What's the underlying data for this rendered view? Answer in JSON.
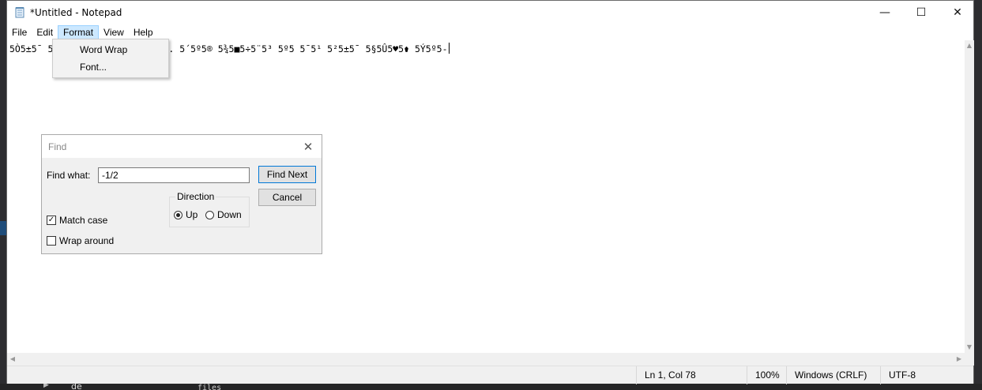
{
  "window": {
    "title": "*Untitled - Notepad",
    "minimize_glyph": "—",
    "maximize_glyph": "☐",
    "close_glyph": "✕"
  },
  "menu": {
    "file": "File",
    "edit": "Edit",
    "format": "Format",
    "view": "View",
    "help": "Help"
  },
  "format_menu": {
    "word_wrap": "Word Wrap",
    "font": "Font..."
  },
  "editor": {
    "text_start": "5Ò5±5¯ 5",
    "text_end": ". 5´5º5® 5¾5■5÷5¨5³ 5º5 5¯5¹ 5²5±5¯ 5§5Û5♥5⚱ 5Ý5º5-"
  },
  "find_dialog": {
    "title": "Find",
    "close_glyph": "✕",
    "find_what_label": "Find what:",
    "find_what_value": "-1/2",
    "find_next_button": "Find Next",
    "cancel_button": "Cancel",
    "direction_label": "Direction",
    "direction_up": "Up",
    "direction_down": "Down",
    "direction_selected": "Up",
    "match_case_label": "Match case",
    "match_case_checked": true,
    "wrap_around_label": "Wrap around",
    "wrap_around_checked": false,
    "check_glyph": "✓"
  },
  "statusbar": {
    "position": "Ln 1, Col 78",
    "zoom": "100%",
    "line_endings": "Windows (CRLF)",
    "encoding": "UTF-8"
  },
  "background": {
    "taskbar_label": "de",
    "terminal_fragment": "files"
  },
  "colors": {
    "menu_active_bg": "#cce8ff",
    "menu_active_border": "#99d1ff",
    "default_button_border": "#0078d7"
  }
}
